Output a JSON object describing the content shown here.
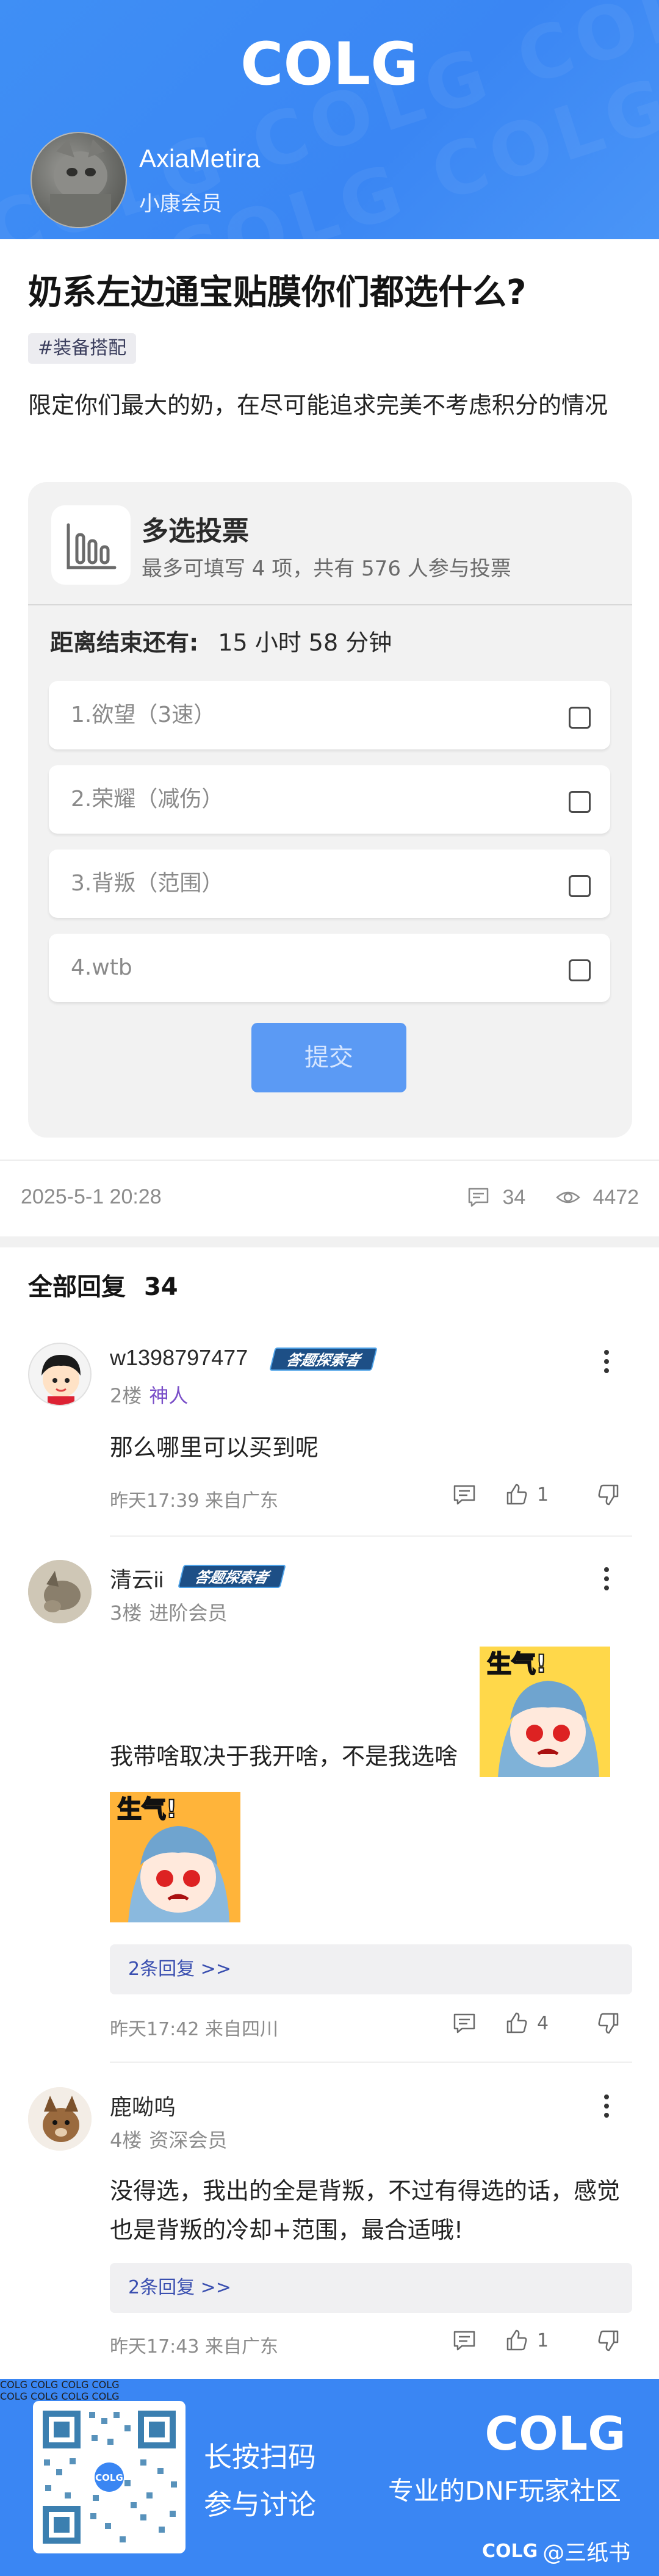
{
  "header": {
    "brand": "COLG",
    "author_name": "AxiaMetira",
    "author_level": "小康会员"
  },
  "post": {
    "title": "奶系左边通宝贴膜你们都选什么?",
    "tag": "#装备搭配",
    "body": "限定你们最大的奶，在尽可能追求完美不考虑积分的情况",
    "date": "2025-5-1 20:28",
    "comment_count": "34",
    "view_count": "4472"
  },
  "poll": {
    "title": "多选投票",
    "subtitle": "最多可填写 4 项，共有 576 人参与投票",
    "countdown_label": "距离结束还有:",
    "countdown_value": "15 小时 58 分钟",
    "options": [
      "1.欲望（3速）",
      "2.荣耀（减伤）",
      "3.背叛（范围）",
      "4.wtb"
    ],
    "submit_label": "提交"
  },
  "replies": {
    "header_label": "全部回复",
    "header_count": "34",
    "items": [
      {
        "name": "w1398797477",
        "badge": "答题探索者",
        "floor": "2楼",
        "rank": "神人",
        "text": "那么哪里可以买到呢",
        "time_loc": "昨天17:39 来自广东",
        "likes": "1"
      },
      {
        "name": "清云ii",
        "badge": "答题探索者",
        "floor": "3楼",
        "rank": "进阶会员",
        "text": "我带啥取决于我开啥，不是我选啥",
        "sticker_text": "生气!",
        "sub_replies": "2条回复 >>",
        "time_loc": "昨天17:42 来自四川",
        "likes": "4"
      },
      {
        "name": "鹿呦呜",
        "floor": "4楼",
        "rank": "资深会员",
        "text": "没得选，我出的全是背叛，不过有得选的话，感觉也是背叛的冷却+范围，最合适哦!",
        "sub_replies": "2条回复 >>",
        "time_loc": "昨天17:43 来自广东",
        "likes": "1"
      }
    ]
  },
  "footer": {
    "qr_brand": "COLG",
    "line1": "长按扫码",
    "line2": "参与讨论",
    "brand": "COLG",
    "slogan": "专业的DNF玩家社区",
    "credit_brand": "COLG",
    "credit": "@三纸书"
  },
  "colors": {
    "brand_blue": "#3a86f3",
    "submit_blue": "#5b9af4",
    "rank_purple": "#7a4fc8",
    "link_blue": "#3a4fb0"
  },
  "icons": [
    "poll-chart-icon",
    "checkbox-icon",
    "comment-icon",
    "eye-icon",
    "more-icon",
    "reply-icon",
    "thumb-up-icon",
    "thumb-down-icon",
    "qr-code-icon"
  ]
}
